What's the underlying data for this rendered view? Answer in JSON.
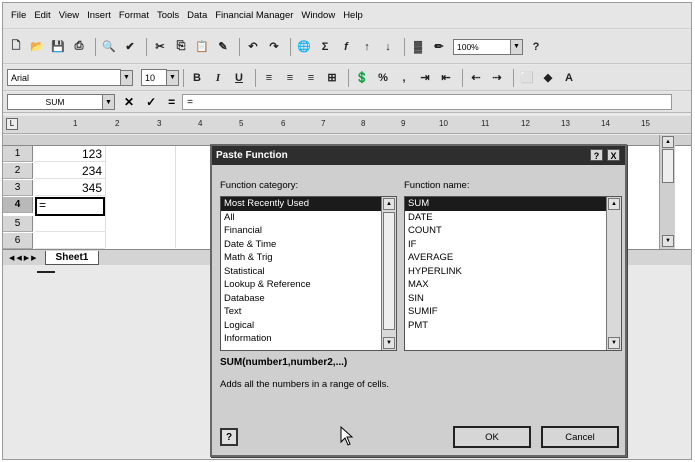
{
  "menu": [
    "File",
    "Edit",
    "View",
    "Insert",
    "Format",
    "Tools",
    "Data",
    "Financial Manager",
    "Window",
    "Help"
  ],
  "toolbar": {
    "zoom": "100%",
    "icons": [
      "new-icon",
      "open-icon",
      "save-icon",
      "print-icon",
      "print-preview-icon",
      "spelling-icon",
      "cut-icon",
      "copy-icon",
      "paste-icon",
      "format-painter-icon",
      "undo-icon",
      "redo-icon",
      "hyperlink-icon",
      "autosum-icon",
      "paste-function-icon",
      "sort-ascending-icon",
      "sort-descending-icon",
      "chart-wizard-icon",
      "drawing-icon",
      "help-icon"
    ]
  },
  "format_toolbar": {
    "font": "Arial",
    "size": "10",
    "bold": "B",
    "italic": "I",
    "underline": "U",
    "percent": "%",
    "comma": ","
  },
  "formula_bar": {
    "name_box": "SUM",
    "cancel": "✕",
    "enter": "✓",
    "equals": "=",
    "content": "="
  },
  "ruler": [
    "1",
    "2",
    "3",
    "4",
    "5",
    "6",
    "7",
    "8",
    "9",
    "10",
    "11",
    "12",
    "13",
    "14",
    "15"
  ],
  "sheet": {
    "rows": [
      {
        "num": "1",
        "value": "123"
      },
      {
        "num": "2",
        "value": "234"
      },
      {
        "num": "3",
        "value": "345"
      },
      {
        "num": "4",
        "value": "="
      },
      {
        "num": "5",
        "value": ""
      },
      {
        "num": "6",
        "value": ""
      }
    ],
    "tab": "Sheet1"
  },
  "dialog": {
    "title": "Paste Function",
    "category_label": "Function category:",
    "categories": [
      "Most Recently Used",
      "All",
      "Financial",
      "Date & Time",
      "Math & Trig",
      "Statistical",
      "Lookup & Reference",
      "Database",
      "Text",
      "Logical",
      "Information"
    ],
    "name_label": "Function name:",
    "functions": [
      "SUM",
      "DATE",
      "COUNT",
      "IF",
      "AVERAGE",
      "HYPERLINK",
      "MAX",
      "SIN",
      "SUMIF",
      "PMT"
    ],
    "syntax": "SUM(number1,number2,...)",
    "description": "Adds all the numbers in a range of cells.",
    "ok": "OK",
    "cancel": "Cancel",
    "help": "?",
    "close": "X"
  }
}
